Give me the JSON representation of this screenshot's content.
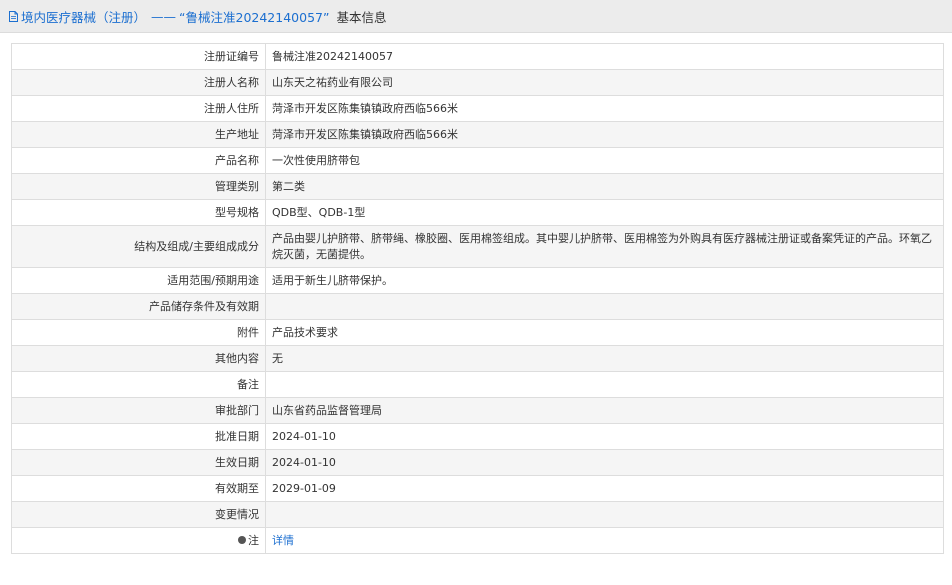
{
  "header": {
    "prefix": "境内医疗器械（注册）",
    "dash": "——",
    "title": "“鲁械注准20242140057”",
    "suffix": "基本信息"
  },
  "rows": [
    {
      "label": "注册证编号",
      "value": "鲁械注准20242140057"
    },
    {
      "label": "注册人名称",
      "value": "山东天之祐药业有限公司"
    },
    {
      "label": "注册人住所",
      "value": "菏泽市开发区陈集镇镇政府西临566米"
    },
    {
      "label": "生产地址",
      "value": "菏泽市开发区陈集镇镇政府西临566米"
    },
    {
      "label": "产品名称",
      "value": "一次性使用脐带包"
    },
    {
      "label": "管理类别",
      "value": "第二类"
    },
    {
      "label": "型号规格",
      "value": "QDB型、QDB-1型"
    },
    {
      "label": "结构及组成/主要组成成分",
      "value": "产品由婴儿护脐带、脐带绳、橡胶圈、医用棉签组成。其中婴儿护脐带、医用棉签为外购具有医疗器械注册证或备案凭证的产品。环氧乙烷灭菌，无菌提供。"
    },
    {
      "label": "适用范围/预期用途",
      "value": "适用于新生儿脐带保护。"
    },
    {
      "label": "产品储存条件及有效期",
      "value": ""
    },
    {
      "label": "附件",
      "value": "产品技术要求"
    },
    {
      "label": "其他内容",
      "value": "无"
    },
    {
      "label": "备注",
      "value": ""
    },
    {
      "label": "审批部门",
      "value": "山东省药品监督管理局"
    },
    {
      "label": "批准日期",
      "value": "2024-01-10"
    },
    {
      "label": "生效日期",
      "value": "2024-01-10"
    },
    {
      "label": "有效期至",
      "value": "2029-01-09"
    },
    {
      "label": "变更情况",
      "value": ""
    }
  ],
  "note_row": {
    "label": "注",
    "link": "详情"
  },
  "colors": {
    "link": "#1c6fd0",
    "header_bg": "#ececec",
    "row_alt_bg": "#f5f5f5",
    "border": "#dddddd"
  },
  "icons": {
    "header": "document-icon",
    "note": "pin-icon"
  }
}
